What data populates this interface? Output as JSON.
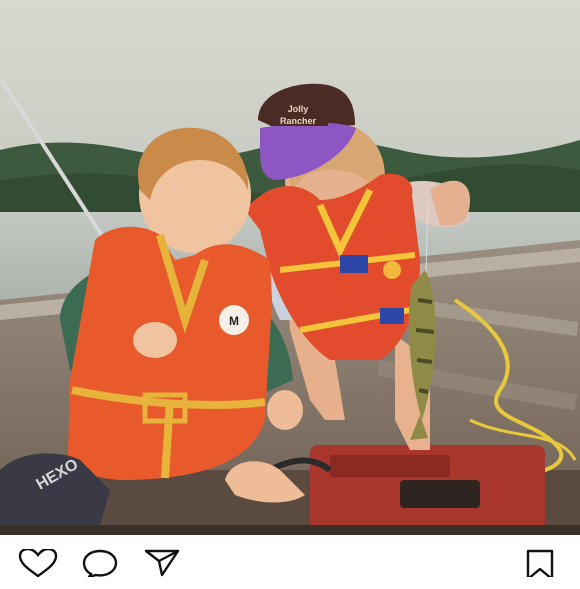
{
  "post": {
    "photo": {
      "cap_text_line1": "Jolly",
      "cap_text_line2": "Rancher",
      "vest_brand_initial": "M",
      "cushion_text": "HEXO"
    }
  },
  "actions": {
    "like_icon": "heart-icon",
    "comment_icon": "speech-bubble-icon",
    "share_icon": "paper-plane-icon",
    "save_icon": "bookmark-icon"
  }
}
